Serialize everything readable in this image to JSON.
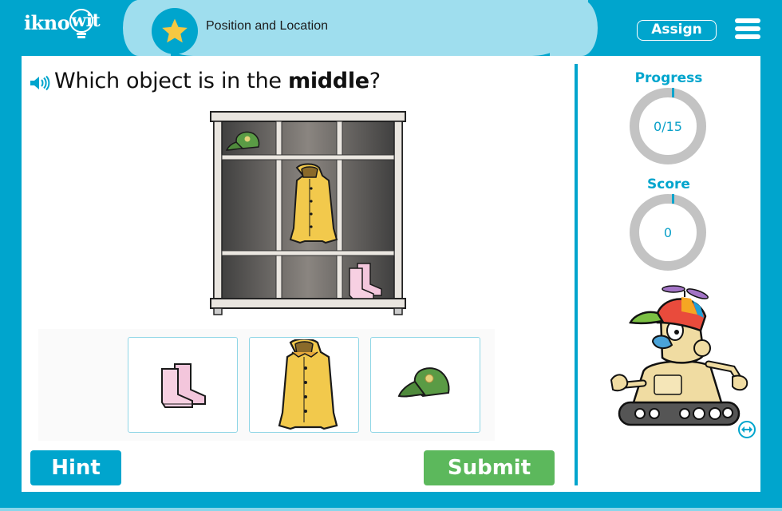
{
  "header": {
    "logo": "iknowit",
    "lesson_title": "Position and Location",
    "assign_label": "Assign",
    "badge_icon": "star-icon",
    "menu_icon": "hamburger-menu-icon"
  },
  "question": {
    "prefix": "Which object is in the ",
    "emphasis": "middle",
    "suffix": "?",
    "audio_icon": "speaker-icon"
  },
  "illustration": {
    "description": "cubby shelf with cap top-left, raincoat in middle, boots bottom-right",
    "items": [
      "cap",
      "raincoat",
      "boots"
    ]
  },
  "choices": [
    {
      "label": "boots",
      "icon": "pink-rain-boots"
    },
    {
      "label": "raincoat",
      "icon": "yellow-raincoat"
    },
    {
      "label": "cap",
      "icon": "green-cap"
    }
  ],
  "buttons": {
    "hint": "Hint",
    "submit": "Submit"
  },
  "sidebar": {
    "progress_label": "Progress",
    "progress_value": "0/15",
    "progress_fraction": 0,
    "score_label": "Score",
    "score_value": "0",
    "mascot": "robot-mascot",
    "expand_icon": "expand-arrows-icon"
  },
  "colors": {
    "brand": "#00a5cd",
    "title_bar": "#9fdeee",
    "submit": "#5cb85c",
    "star": "#f5c842",
    "ring_track": "#c3c3c3"
  }
}
